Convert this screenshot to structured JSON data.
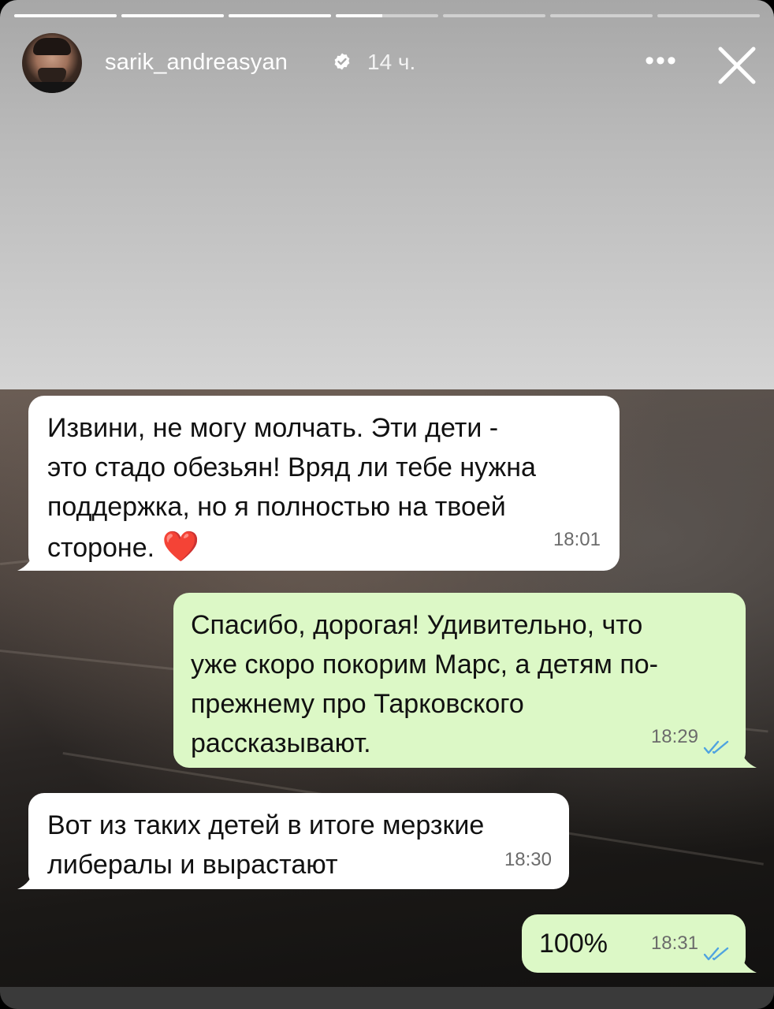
{
  "story": {
    "progress_segments": 7,
    "active_segment_index": 3,
    "active_segment_fraction": 0.45,
    "user": {
      "username": "sarik_andreasyan",
      "verified": true,
      "posted_ago": "14 ч."
    },
    "more_icon": "ellipsis-horizontal-icon",
    "close_icon": "close-x-icon"
  },
  "chat": {
    "messages": [
      {
        "direction": "incoming",
        "text": "Извини, не могу молчать. Эти дети -\nэто стадо обезьян! Вряд ли тебе нужна\nподдержка, но я полностью на твоей\nстороне. ",
        "emoji": "❤️",
        "time": "18:01"
      },
      {
        "direction": "outgoing",
        "text": "Спасибо, дорогая! Удивительно, что\nуже скоро покорим Марс, а детям по-\nпрежнему про Тарковского\nрассказывают.",
        "time": "18:29",
        "read": true
      },
      {
        "direction": "incoming",
        "text": "Вот из таких детей в итоге мерзкие\nлибералы и вырастают",
        "time": "18:30"
      },
      {
        "direction": "outgoing",
        "text": "100%",
        "time": "18:31",
        "read": true
      }
    ],
    "colors": {
      "incoming": "#ffffff",
      "outgoing": "#dcf8c6",
      "read_ticks": "#4fa3e0"
    }
  }
}
